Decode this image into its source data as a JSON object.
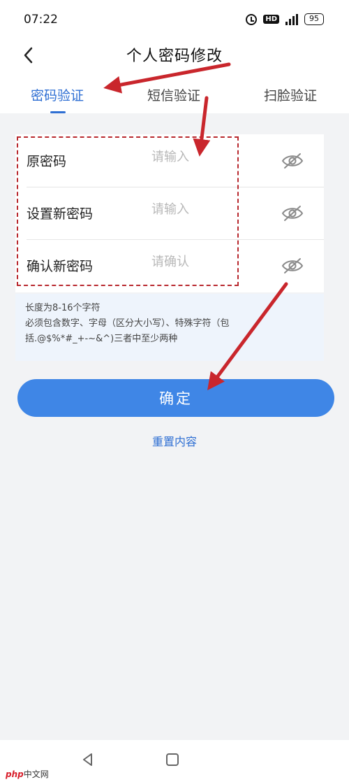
{
  "status_bar": {
    "time": "07:22",
    "battery": "95",
    "hd_badge": "HD"
  },
  "header": {
    "title": "个人密码修改"
  },
  "tabs": [
    {
      "label": "密码验证",
      "active": true
    },
    {
      "label": "短信验证",
      "active": false
    },
    {
      "label": "扫脸验证",
      "active": false
    }
  ],
  "form": {
    "rows": [
      {
        "label": "原密码",
        "value": "",
        "placeholder": "请输入"
      },
      {
        "label": "设置新密码",
        "value": "",
        "placeholder": "请输入"
      },
      {
        "label": "确认新密码",
        "value": "",
        "placeholder": "请确认"
      }
    ]
  },
  "hint": {
    "line1": "长度为8-16个字符",
    "line2": "必须包含数字、字母（区分大小写）、特殊字符（包",
    "line3": "括.@$%*#_+-~&^)三者中至少两种"
  },
  "actions": {
    "confirm_label": "确定",
    "reset_label": "重置内容"
  },
  "watermark": {
    "brand": "php",
    "site": "中文网"
  },
  "colors": {
    "accent": "#2f6fd3",
    "button": "#3f86e6",
    "annotation": "#c9262c"
  },
  "icons": {
    "back": "chevron-left-icon",
    "password_toggle": "eye-off-icon",
    "alarm": "alarm-icon",
    "signal": "signal-icon",
    "battery": "battery-icon"
  }
}
